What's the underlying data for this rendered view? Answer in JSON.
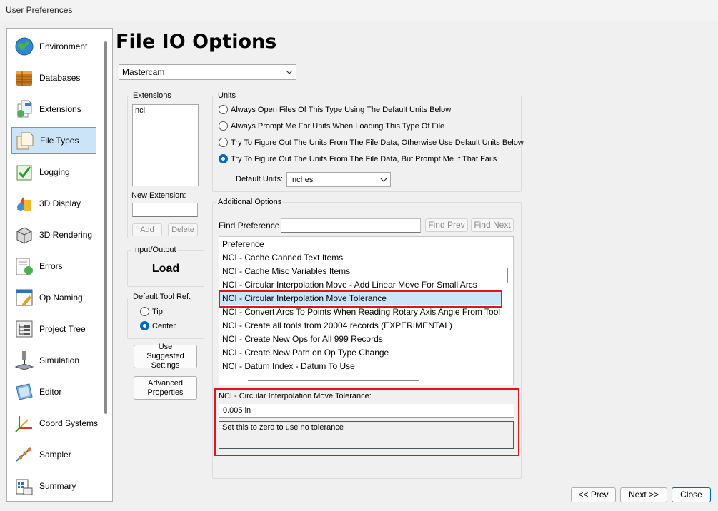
{
  "window": {
    "title": "User Preferences"
  },
  "sidebar": {
    "items": [
      {
        "label": "Environment",
        "icon": "globe-icon"
      },
      {
        "label": "Databases",
        "icon": "database-icon"
      },
      {
        "label": "Extensions",
        "icon": "file-extension-icon"
      },
      {
        "label": "File Types",
        "icon": "file-types-icon",
        "selected": true
      },
      {
        "label": "Logging",
        "icon": "logging-icon"
      },
      {
        "label": "3D Display",
        "icon": "3d-display-icon"
      },
      {
        "label": "3D Rendering",
        "icon": "3d-rendering-icon"
      },
      {
        "label": "Errors",
        "icon": "errors-icon"
      },
      {
        "label": "Op Naming",
        "icon": "op-naming-icon"
      },
      {
        "label": "Project Tree",
        "icon": "project-tree-icon"
      },
      {
        "label": "Simulation",
        "icon": "simulation-icon"
      },
      {
        "label": "Editor",
        "icon": "editor-icon"
      },
      {
        "label": "Coord Systems",
        "icon": "coord-systems-icon"
      },
      {
        "label": "Sampler",
        "icon": "sampler-icon"
      },
      {
        "label": "Summary",
        "icon": "summary-icon"
      }
    ]
  },
  "main": {
    "title": "File IO Options",
    "file_type_select": {
      "value": "Mastercam"
    },
    "extensions": {
      "label": "Extensions",
      "items": [
        "nci"
      ],
      "new_extension_label": "New Extension:",
      "new_extension_value": "",
      "add_label": "Add",
      "delete_label": "Delete"
    },
    "io": {
      "label": "Input/Output",
      "value": "Load"
    },
    "default_tool_ref": {
      "label": "Default Tool Ref.",
      "options": [
        "Tip",
        "Center"
      ],
      "selected": "Center"
    },
    "use_suggested_label": "Use Suggested Settings",
    "advanced_label": "Advanced Properties",
    "units": {
      "label": "Units",
      "options": [
        "Always Open Files Of This Type Using The Default Units Below",
        "Always Prompt Me For Units When Loading This Type Of File",
        "Try To Figure Out The Units From The File Data, Otherwise Use Default Units Below",
        "Try To Figure Out The Units From The File Data, But Prompt Me If That Fails"
      ],
      "selected_index": 3,
      "default_units_label": "Default Units:",
      "default_units_value": "Inches"
    },
    "additional": {
      "label": "Additional Options",
      "find_label": "Find Preference",
      "find_value": "",
      "find_prev_label": "Find Prev",
      "find_next_label": "Find Next",
      "list_header": "Preference",
      "rows": [
        "NCI - Cache Canned Text Items",
        "NCI - Cache Misc Variables Items",
        "NCI - Circular Interpolation Move - Add Linear Move For Small Arcs",
        "NCI - Circular Interpolation Move Tolerance",
        "NCI - Convert Arcs To Points When Reading Rotary Axis Angle From Tool Vector",
        "NCI - Create all tools from 20004 records (EXPERIMENTAL)",
        "NCI - Create New Ops for All 999 Records",
        "NCI - Create New Path on Op Type Change",
        "NCI - Datum Index - Datum To Use"
      ],
      "selected_index": 3,
      "detail": {
        "name": "NCI - Circular Interpolation Move Tolerance:",
        "value": "0.005 in",
        "description": "Set this to zero to use no tolerance"
      }
    }
  },
  "footer": {
    "prev_label": "<< Prev",
    "next_label": "Next >>",
    "close_label": "Close"
  },
  "colors": {
    "selection": "#cce4f7",
    "highlight_box": "#e0151c",
    "accent": "#0067c0"
  }
}
